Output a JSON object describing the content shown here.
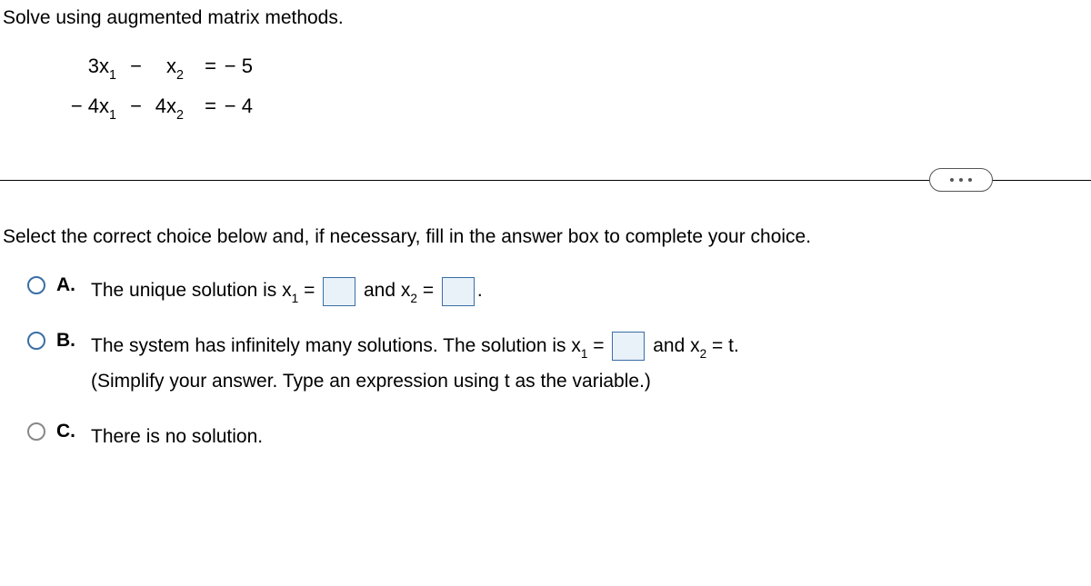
{
  "question": {
    "prompt": "Solve using augmented matrix methods.",
    "instruction": "Select the correct choice below and, if necessary, fill in the answer box to complete your choice."
  },
  "equations": {
    "row1": {
      "a11": "3x",
      "sub1": "1",
      "op": "−",
      "a12": "x",
      "sub2": "2",
      "eq": "=",
      "rhs": "− 5"
    },
    "row2": {
      "a21": "− 4x",
      "sub1": "1",
      "op": "−",
      "a22": "4x",
      "sub2": "2",
      "eq": "=",
      "rhs": "− 4"
    }
  },
  "choices": {
    "A": {
      "letter": "A.",
      "text_before": "The unique solution is x",
      "sub1": "1",
      "mid1": " = ",
      "mid2": " and x",
      "sub2": "2",
      "mid3": " = ",
      "after": "."
    },
    "B": {
      "letter": "B.",
      "text_before": "The system has infinitely many solutions. The solution is x",
      "sub1": "1",
      "mid1": " = ",
      "mid2": " and x",
      "sub2": "2",
      "mid3": " = t.",
      "hint": "(Simplify your answer. Type an expression using t as the variable.)"
    },
    "C": {
      "letter": "C.",
      "text": "There is no solution."
    }
  }
}
